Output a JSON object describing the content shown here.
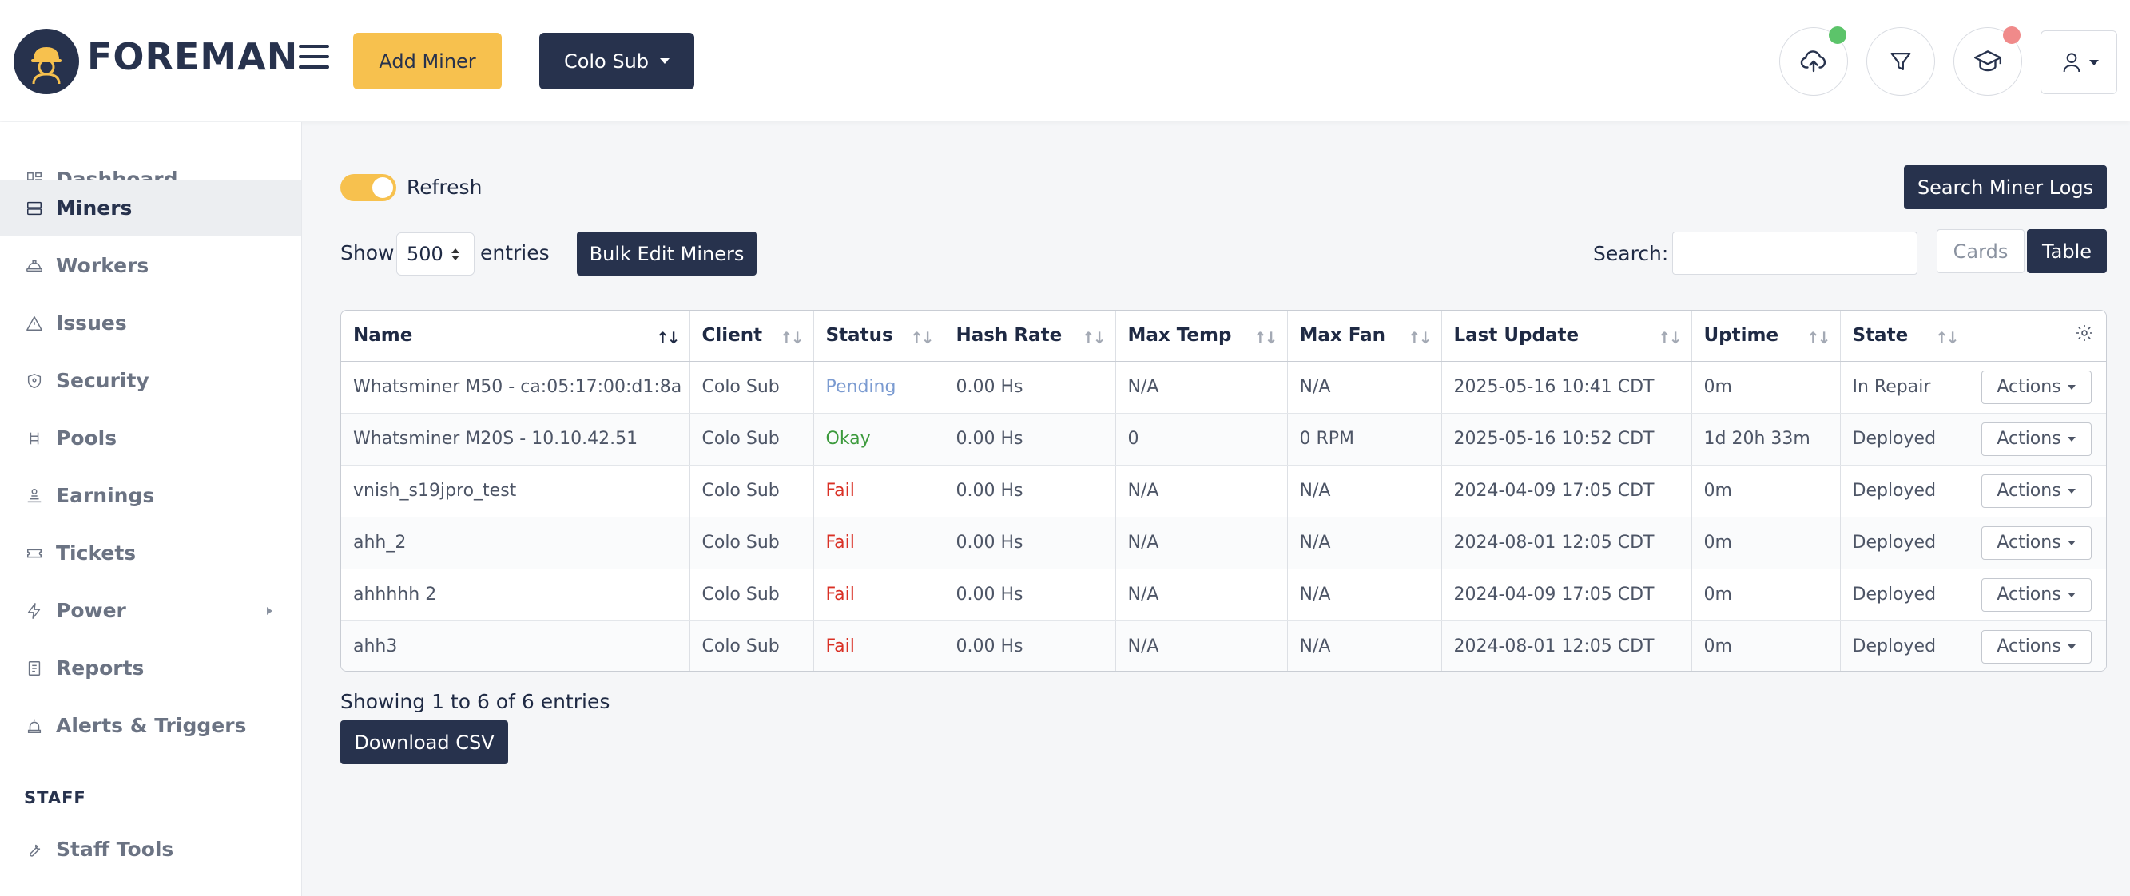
{
  "header": {
    "logo_text": "FOREMAN",
    "add_miner_label": "Add Miner",
    "client_selector_label": "Colo Sub"
  },
  "sidebar": {
    "items": [
      {
        "label": "Dashboard",
        "icon": "dashboard-icon"
      },
      {
        "label": "Miners",
        "icon": "server-icon",
        "active": true
      },
      {
        "label": "Workers",
        "icon": "hard-hat-icon"
      },
      {
        "label": "Issues",
        "icon": "warning-icon"
      },
      {
        "label": "Security",
        "icon": "shield-icon"
      },
      {
        "label": "Pools",
        "icon": "pools-icon"
      },
      {
        "label": "Earnings",
        "icon": "earnings-icon"
      },
      {
        "label": "Tickets",
        "icon": "ticket-icon"
      },
      {
        "label": "Power",
        "icon": "bolt-icon",
        "has_submenu": true
      },
      {
        "label": "Reports",
        "icon": "report-icon"
      },
      {
        "label": "Alerts & Triggers",
        "icon": "alarm-icon"
      }
    ],
    "staff_section_title": "STAFF",
    "staff_items": [
      {
        "label": "Staff Tools",
        "icon": "wrench-icon"
      }
    ]
  },
  "toolbar": {
    "refresh_label": "Refresh",
    "refresh_on": true,
    "search_logs_label": "Search Miner Logs",
    "show_label": "Show",
    "entries_value": "500",
    "entries_label": "entries",
    "bulk_edit_label": "Bulk Edit Miners",
    "search_label": "Search:",
    "search_value": "",
    "cards_label": "Cards",
    "table_label": "Table"
  },
  "table": {
    "columns": [
      "Name",
      "Client",
      "Status",
      "Hash Rate",
      "Max Temp",
      "Max Fan",
      "Last Update",
      "Uptime",
      "State"
    ],
    "rows": [
      {
        "name": "Whatsminer M50 - ca:05:17:00:d1:8a",
        "client": "Colo Sub",
        "status": "Pending",
        "status_kind": "pending",
        "hash_rate": "0.00 Hs",
        "max_temp": "N/A",
        "max_fan": "N/A",
        "last_update": "2025-05-16 10:41 CDT",
        "uptime": "0m",
        "state": "In Repair",
        "actions": "Actions"
      },
      {
        "name": "Whatsminer M20S - 10.10.42.51",
        "client": "Colo Sub",
        "status": "Okay",
        "status_kind": "okay",
        "hash_rate": "0.00 Hs",
        "max_temp": "0",
        "max_fan": "0 RPM",
        "last_update": "2025-05-16 10:52 CDT",
        "uptime": "1d 20h 33m",
        "state": "Deployed",
        "actions": "Actions"
      },
      {
        "name": "vnish_s19jpro_test",
        "client": "Colo Sub",
        "status": "Fail",
        "status_kind": "fail",
        "hash_rate": "0.00 Hs",
        "max_temp": "N/A",
        "max_fan": "N/A",
        "last_update": "2024-04-09 17:05 CDT",
        "uptime": "0m",
        "state": "Deployed",
        "actions": "Actions"
      },
      {
        "name": "ahh_2",
        "client": "Colo Sub",
        "status": "Fail",
        "status_kind": "fail",
        "hash_rate": "0.00 Hs",
        "max_temp": "N/A",
        "max_fan": "N/A",
        "last_update": "2024-08-01 12:05 CDT",
        "uptime": "0m",
        "state": "Deployed",
        "actions": "Actions"
      },
      {
        "name": "ahhhhh 2",
        "client": "Colo Sub",
        "status": "Fail",
        "status_kind": "fail",
        "hash_rate": "0.00 Hs",
        "max_temp": "N/A",
        "max_fan": "N/A",
        "last_update": "2024-04-09 17:05 CDT",
        "uptime": "0m",
        "state": "Deployed",
        "actions": "Actions"
      },
      {
        "name": "ahh3",
        "client": "Colo Sub",
        "status": "Fail",
        "status_kind": "fail",
        "hash_rate": "0.00 Hs",
        "max_temp": "N/A",
        "max_fan": "N/A",
        "last_update": "2024-08-01 12:05 CDT",
        "uptime": "0m",
        "state": "Deployed",
        "actions": "Actions"
      }
    ]
  },
  "footer": {
    "showing_text": "Showing 1 to 6 of 6 entries",
    "download_csv_label": "Download CSV"
  },
  "colors": {
    "navy": "#27324d",
    "accent_yellow": "#f7c14e",
    "status_pending": "#7b9bd1",
    "status_okay": "#3c9a3c",
    "status_fail": "#d93025",
    "notify_green": "#5cc46a",
    "notify_red": "#f08a8a"
  }
}
